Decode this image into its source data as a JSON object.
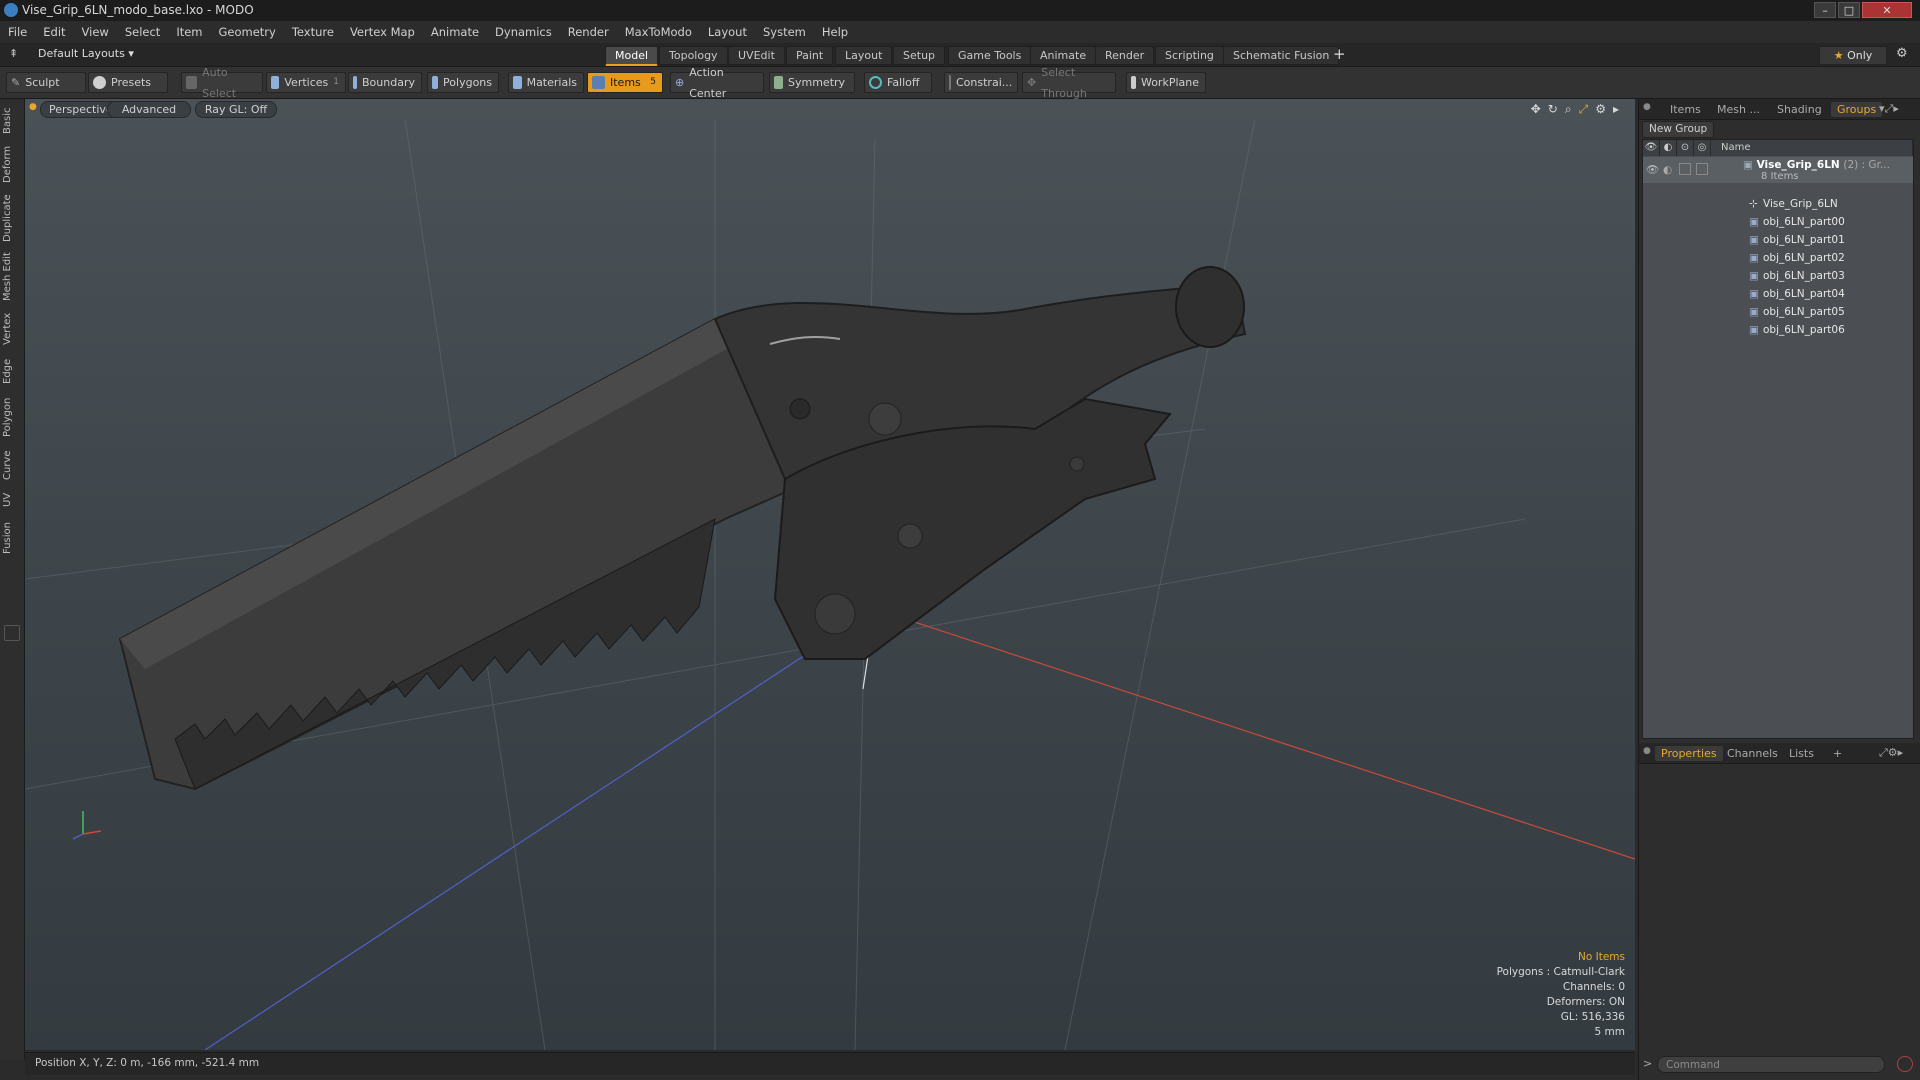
{
  "window": {
    "title": "Vise_Grip_6LN_modo_base.lxo - MODO"
  },
  "menubar": [
    "File",
    "Edit",
    "View",
    "Select",
    "Item",
    "Geometry",
    "Texture",
    "Vertex Map",
    "Animate",
    "Dynamics",
    "Render",
    "MaxToModo",
    "Layout",
    "System",
    "Help"
  ],
  "layouts": {
    "selector": "Default Layouts",
    "tabs": [
      "Model",
      "Topology",
      "UVEdit",
      "Paint",
      "Layout",
      "Setup",
      "Game Tools",
      "Animate",
      "Render",
      "Scripting",
      "Schematic Fusion"
    ],
    "active": "Model",
    "only_label": "Only"
  },
  "toolbar": {
    "sculpt": "Sculpt",
    "presets": "Presets",
    "auto_select": "Auto Select",
    "vertices": "Vertices",
    "vertices_count": "1",
    "boundary": "Boundary",
    "polygons": "Polygons",
    "materials": "Materials",
    "items": "Items",
    "items_count": "5",
    "action_center": "Action Center",
    "symmetry": "Symmetry",
    "falloff": "Falloff",
    "constraints": "Constrai...",
    "select_through": "Select Through",
    "workplane": "WorkPlane"
  },
  "left_tabs": [
    "Basic",
    "Deform",
    "Duplicate",
    "Mesh Edit",
    "Vertex",
    "Edge",
    "Polygon",
    "Curve",
    "UV",
    "Fusion"
  ],
  "viewport": {
    "perspective": "Perspective",
    "advanced": "Advanced",
    "raygl": "Ray GL: Off",
    "info": {
      "no_items": "No Items",
      "polygons": "Polygons : Catmull-Clark",
      "channels": "Channels: 0",
      "deformers": "Deformers: ON",
      "gl": "GL: 516,336",
      "scale": "5 mm"
    }
  },
  "status": {
    "position": "Position X, Y, Z:  0 m, -166 mm, -521.4 mm"
  },
  "right_panel": {
    "top_tabs": [
      "Items",
      "Mesh ...",
      "Shading",
      "Groups"
    ],
    "active_top": "Groups",
    "new_group": "New Group",
    "name_header": "Name",
    "group_name": "Vise_Grip_6LN",
    "group_suffix": "(2) : Gr...",
    "group_count": "8 Items",
    "children": [
      "Vise_Grip_6LN",
      "obj_6LN_part00",
      "obj_6LN_part01",
      "obj_6LN_part02",
      "obj_6LN_part03",
      "obj_6LN_part04",
      "obj_6LN_part05",
      "obj_6LN_part06"
    ],
    "bottom_tabs": [
      "Properties",
      "Channels",
      "Lists",
      "+"
    ],
    "active_bottom": "Properties",
    "command_placeholder": "Command"
  }
}
